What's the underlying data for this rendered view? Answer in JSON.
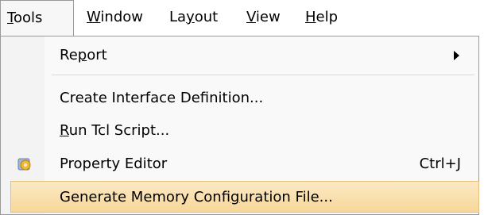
{
  "menubar": {
    "items": [
      {
        "label": "Tools",
        "mnemonic": "T",
        "rest": "ools",
        "active": true
      },
      {
        "label": "Window",
        "mnemonic": "W",
        "rest": "indow"
      },
      {
        "label": "Layout",
        "pre": "La",
        "mnemonic": "y",
        "rest": "out"
      },
      {
        "label": "View",
        "mnemonic": "V",
        "rest": "iew"
      },
      {
        "label": "Help",
        "mnemonic": "H",
        "rest": "elp"
      }
    ]
  },
  "menu": {
    "items": [
      {
        "label": "Report",
        "pre": "Re",
        "mnemonic": "p",
        "rest": "ort",
        "submenu": true
      },
      {
        "label": "Create Interface Definition..."
      },
      {
        "label": "Run Tcl Script...",
        "pre": "",
        "mnemonic": "R",
        "rest": "un Tcl Script..."
      },
      {
        "label": "Property Editor",
        "shortcut": "Ctrl+J",
        "icon": "property-editor-icon"
      },
      {
        "label": "Generate Memory Configuration File...",
        "pre": "Generate Memory Confi",
        "mnemonic": "g",
        "rest": "uration File...",
        "highlighted": true
      }
    ]
  },
  "colors": {
    "highlight": "#f7d79a",
    "menu_background": "#f9f9f9",
    "icon_color": "#e8a317"
  }
}
